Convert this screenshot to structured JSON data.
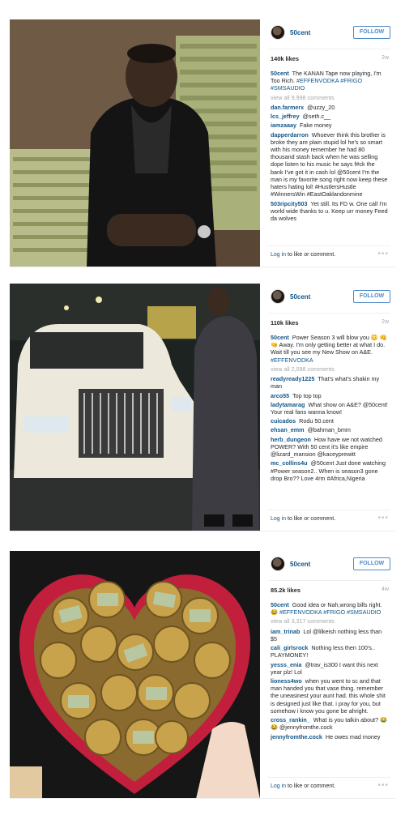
{
  "posts": [
    {
      "username": "50cent",
      "follow_label": "FOLLOW",
      "likes": "140k likes",
      "age": "2w",
      "caption_user": "50cent",
      "caption_text": "The KANAN Tape now playing, I'm Too Rich.",
      "caption_tags": "#EFFENVODKA #FRIGO #SMSAUDIO",
      "view_all": "view all 9,998 comments",
      "comments": [
        {
          "user": "dan.farmerx",
          "text": "@uzzy_20"
        },
        {
          "user": "lcs_jeffrey",
          "text": "@seth.c__"
        },
        {
          "user": "iamzaaay",
          "text": "Fake money"
        },
        {
          "user": "dapperdarron",
          "text": "Whoever think this brother is broke they are plain stupid lol he's so smart with his money remember he had 80 thousand stash back when he was selling dope listen to his music he says f#ck the bank I've got it in cash lol @50cent I'm the man is my favorite song right now keep these haters hating lol! #HustlersHustle #WinnersWin #EastOaklandonmine"
        },
        {
          "user": "503ripcity503",
          "text": "Yet still. Its FD w. One call I'm world wide thanks to u. Keep urr money Feed da wolves"
        }
      ],
      "login_link": "Log in",
      "login_rest": "to like or comment.",
      "more": "•••"
    },
    {
      "username": "50cent",
      "follow_label": "FOLLOW",
      "likes": "110k likes",
      "age": "2w",
      "caption_user": "50cent",
      "caption_text": "Power Season 3 will blow you 😳 👊 🤜 Away. I'm only getting better at what I do. Wait till you see my New Show on A&E.",
      "caption_tags": "#EFFENVODKA",
      "view_all": "view all 2,098 comments",
      "comments": [
        {
          "user": "readyready1225",
          "text": "That's what's shakin my man"
        },
        {
          "user": "arco55",
          "text": "Top top top"
        },
        {
          "user": "ladytamarag",
          "text": "What show on A&E? @50cent! Your real fans wanna know!"
        },
        {
          "user": "cuicados",
          "text": "Rodu 50.cent"
        },
        {
          "user": "ehsan_emm",
          "text": "@bahman_bmm"
        },
        {
          "user": "herb_dungeon",
          "text": "How have we not watched POWER? With 50 cent it's like empire @lizard_mansion @kaceyprewitt"
        },
        {
          "user": "mc_collins4u",
          "text": "@50cent Just done watching #Power season2.. When is season3 gone drop Bro?? Love 4rm #Africa,Nigeria"
        }
      ],
      "login_link": "Log in",
      "login_rest": "to like or comment.",
      "more": "•••"
    },
    {
      "username": "50cent",
      "follow_label": "FOLLOW",
      "likes": "85.2k likes",
      "age": "4w",
      "caption_user": "50cent",
      "caption_text": "Good idea or Nah,wrong bills right. 😂",
      "caption_tags": "#EFFENVODKA #FRIGO #SMSAUDIO",
      "view_all": "view all 3,317 comments",
      "comments": [
        {
          "user": "iam_trinab",
          "text": "Lol @lilkeish nothing less than $5"
        },
        {
          "user": "cali_girlsrock",
          "text": "Nothing less then 100's.. PLAYMONEY!"
        },
        {
          "user": "yesss_enia",
          "text": "@trav_is300 I want this next year plz! Lol"
        },
        {
          "user": "lioness4wo",
          "text": "when you went to sc and that man handed you that vase thing. remember the uneasinest your aunt had. this whole shit is designed just like that. i pray for you, but somehow i know you gone be ahright."
        },
        {
          "user": "cross_rankin_",
          "text": "What is you talkin about? 😂😂 @jennyfromthe.cock"
        },
        {
          "user": "jennyfromthe.cock",
          "text": "He owes mad money"
        }
      ],
      "login_link": "Log in",
      "login_rest": "to like or comment.",
      "more": "•••"
    }
  ],
  "colors": {
    "link": "#125688",
    "follow": "#4f8bc7",
    "muted": "#a5a7aa"
  }
}
